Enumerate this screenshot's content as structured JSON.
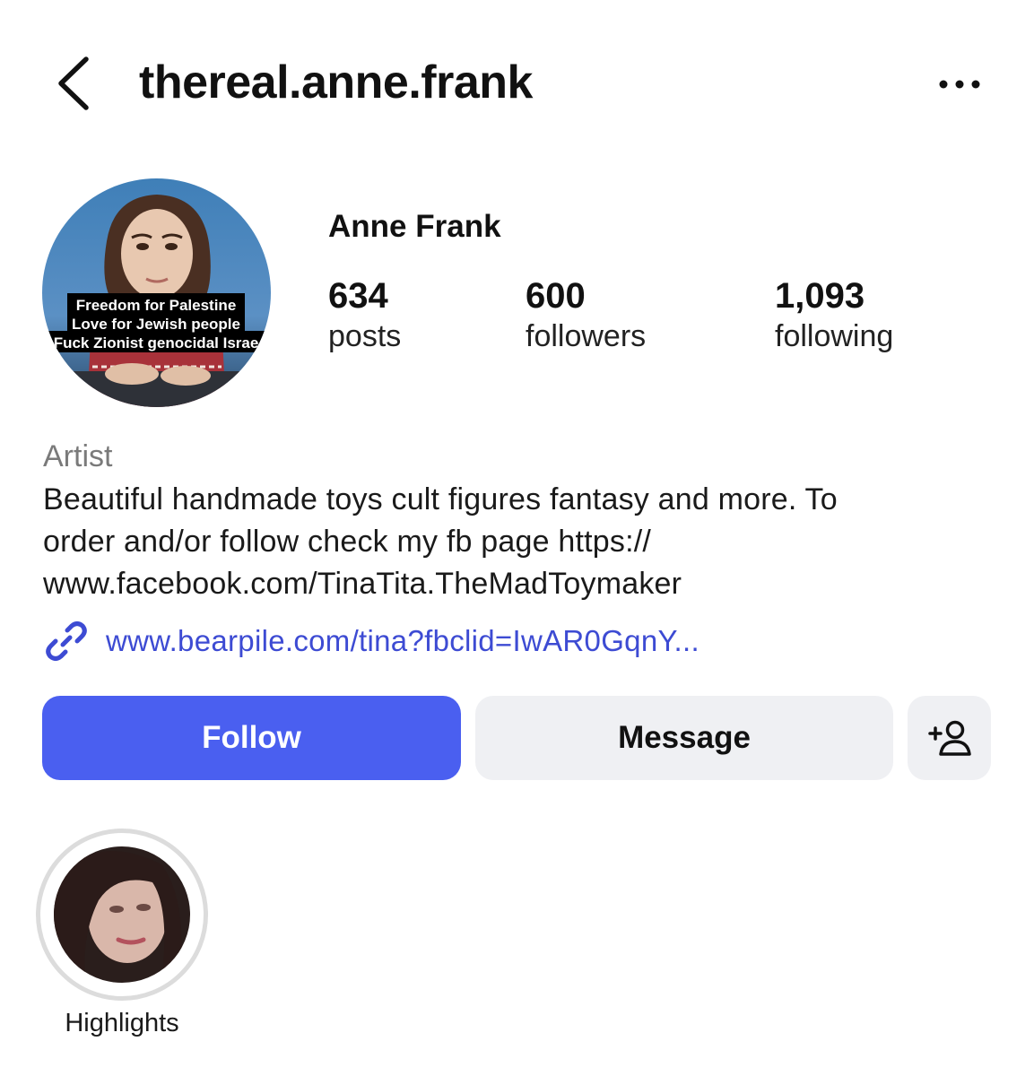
{
  "header": {
    "username": "thereal.anne.frank",
    "back_icon": "chevron-left-icon",
    "more_icon": "more-horizontal-icon"
  },
  "profile": {
    "display_name": "Anne Frank",
    "avatar_caption": {
      "line1": "Freedom for Palestine",
      "line2": "Love for Jewish people",
      "line3": "Fuck Zionist genocidal Israe"
    },
    "stats": {
      "posts": {
        "value": "634",
        "label": "posts"
      },
      "followers": {
        "value": "600",
        "label": "followers"
      },
      "following": {
        "value": "1,093",
        "label": "following"
      }
    },
    "category": "Artist",
    "bio": "Beautiful handmade toys cult figures fantasy and more. To\norder and/or follow check my fb page https://\nwww.facebook.com/TinaTita.TheMadToymaker",
    "link": "www.bearpile.com/tina?fbclid=IwAR0GqnY..."
  },
  "actions": {
    "follow_label": "Follow",
    "message_label": "Message",
    "add_person_icon": "add-person-icon"
  },
  "highlights": [
    {
      "label": "Highlights"
    }
  ],
  "colors": {
    "follow_bg": "#4a5ff0",
    "secondary_btn_bg": "#eff0f3",
    "link": "#3d4bd3",
    "category": "#7a7a7a"
  }
}
